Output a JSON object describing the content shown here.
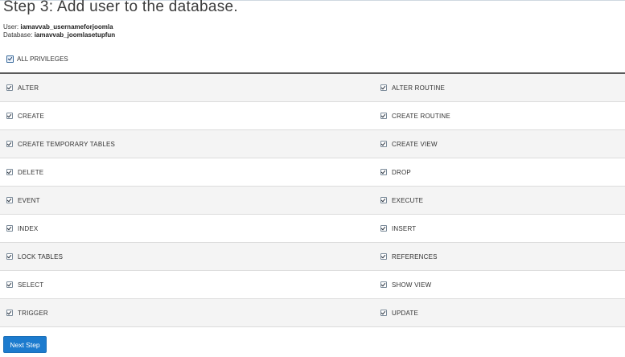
{
  "page": {
    "title": "Step 3: Add user to the database.",
    "user_label": "User:",
    "user_value": "iamavvab_usernameforjoomla",
    "database_label": "Database:",
    "database_value": "iamavvab_joomlasetupfun"
  },
  "all_privileges": {
    "label": "ALL PRIVILEGES",
    "checked": true
  },
  "privileges": [
    {
      "left": "ALTER",
      "right": "ALTER ROUTINE"
    },
    {
      "left": "CREATE",
      "right": "CREATE ROUTINE"
    },
    {
      "left": "CREATE TEMPORARY TABLES",
      "right": "CREATE VIEW"
    },
    {
      "left": "DELETE",
      "right": "DROP"
    },
    {
      "left": "EVENT",
      "right": "EXECUTE"
    },
    {
      "left": "INDEX",
      "right": "INSERT"
    },
    {
      "left": "LOCK TABLES",
      "right": "REFERENCES"
    },
    {
      "left": "SELECT",
      "right": "SHOW VIEW"
    },
    {
      "left": "TRIGGER",
      "right": "UPDATE"
    }
  ],
  "all_checked": true,
  "next_button": {
    "label": "Next Step"
  },
  "colors": {
    "accent": "#1c7bce",
    "row_stripe": "#f4f4f4",
    "divider": "#5a5a5a"
  }
}
